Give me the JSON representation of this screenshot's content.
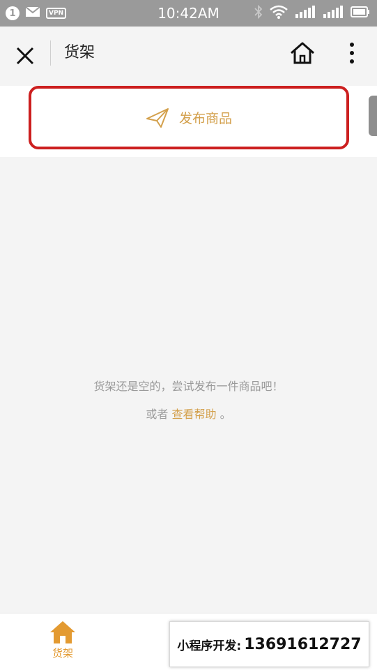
{
  "status_bar": {
    "badge": "1",
    "vpn": "VPN",
    "time": "10:42AM"
  },
  "header": {
    "title": "货架"
  },
  "publish": {
    "label": "发布商品",
    "border_color": "#cc1f1f",
    "accent_color": "#d3a04c"
  },
  "empty_state": {
    "message": "货架还是空的，尝试发布一件商品吧！",
    "help_prefix": "或者",
    "help_link": "查看帮助",
    "help_suffix": "。"
  },
  "tabbar": {
    "shelf_label": "货架",
    "active_color": "#e39a31"
  },
  "promo": {
    "label": "小程序开发:",
    "number": "13691612727"
  }
}
